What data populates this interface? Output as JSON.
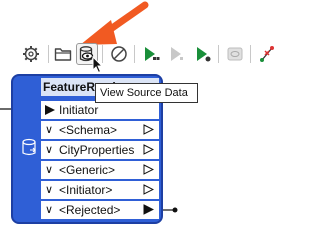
{
  "toolbar": {
    "items": [
      {
        "name": "gear-icon"
      },
      {
        "name": "folder-icon"
      },
      {
        "name": "view-source-data-icon"
      },
      {
        "name": "disable-icon"
      },
      {
        "name": "run-icon"
      },
      {
        "name": "run-disabled-icon"
      },
      {
        "name": "run-to-icon"
      },
      {
        "name": "inspect-icon"
      },
      {
        "name": "connect-icon"
      }
    ]
  },
  "tooltip": {
    "text": "View Source Data"
  },
  "node": {
    "title": "FeatureReader",
    "input_port": "Initiator",
    "output_ports": [
      "<Schema>",
      "CityProperties",
      "<Generic>",
      "<Initiator>",
      "<Rejected>"
    ]
  },
  "colors": {
    "node_fill": "#2f5fd6",
    "arrow": "#f15a22",
    "run_green": "#1a8f3a"
  }
}
